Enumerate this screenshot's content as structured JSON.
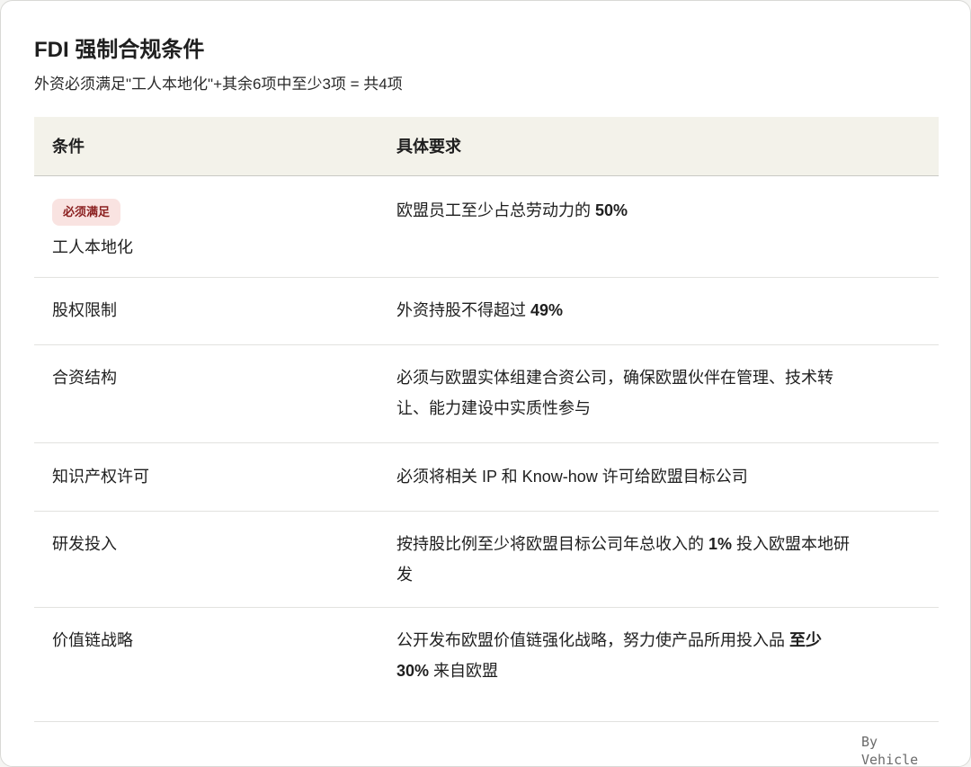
{
  "header": {
    "title": "FDI 强制合规条件",
    "subtitle": "外资必须满足\"工人本地化\"+其余6项中至少3项 = 共4项"
  },
  "table": {
    "col_condition": "条件",
    "col_requirement": "具体要求",
    "rows": [
      {
        "badge": "必须满足",
        "condition": "工人本地化",
        "req_pre": "欧盟员工至少占总劳动力的 ",
        "req_bold": "50%",
        "req_post": ""
      },
      {
        "condition": "股权限制",
        "req_pre": "外资持股不得超过 ",
        "req_bold": "49%",
        "req_post": ""
      },
      {
        "condition": "合资结构",
        "req_line1": "必须与欧盟实体组建合资公司，确保欧盟伙伴在管理、技术转",
        "req_line2": "让、能力建设中实质性参与"
      },
      {
        "condition": "知识产权许可",
        "req_text": "必须将相关 IP 和 Know-how 许可给欧盟目标公司"
      },
      {
        "condition": "研发投入",
        "req_pre": "按持股比例至少将欧盟目标公司年总收入的 ",
        "req_bold": "1%",
        "req_post": " 投入欧盟本地研",
        "req_line2": "发"
      },
      {
        "condition": "价值链战略",
        "req_pre": "公开发布欧盟价值链强化战略，努力使产品所用投入品 ",
        "req_bold": "至少",
        "req_line2_bold": "30%",
        "req_line2_post": " 来自欧盟"
      }
    ]
  },
  "footer": {
    "by": "By",
    "brand": "Vehicle"
  }
}
